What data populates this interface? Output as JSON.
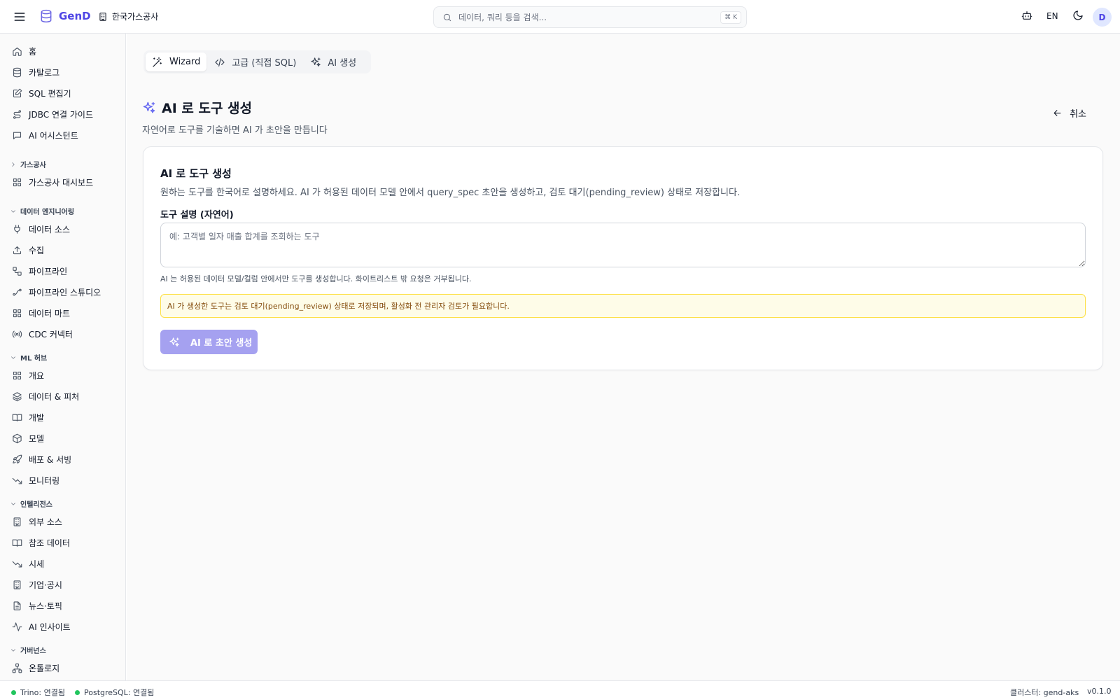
{
  "colors": {
    "accent": "#4f46e5",
    "status_ok": "#22c55e",
    "alert_bg": "#fefce8",
    "alert_border": "#fde047",
    "alert_text": "#854d0e"
  },
  "topbar": {
    "brand": "GenD",
    "org": "한국가스공사",
    "search_placeholder": "데이터, 쿼리 등을 검색...",
    "search_shortcut": "⌘ K",
    "lang": "EN",
    "avatar": "D"
  },
  "sidebar": {
    "items_top": [
      {
        "label": "홈",
        "icon": "home-icon"
      },
      {
        "label": "카탈로그",
        "icon": "database-icon"
      },
      {
        "label": "SQL 편집기",
        "icon": "edit-icon"
      },
      {
        "label": "JDBC 연결 가이드",
        "icon": "route-icon"
      },
      {
        "label": "AI 어시스턴트",
        "icon": "message-icon"
      }
    ],
    "sections": {
      "gas": "가스공사",
      "de": "데이터 엔지니어링",
      "ml": "ML 허브",
      "intel": "인텔리전스",
      "gov": "거버넌스"
    },
    "gas_items": [
      {
        "label": "가스공사 대시보드",
        "icon": "grid-icon"
      }
    ],
    "de_items": [
      {
        "label": "데이터 소스",
        "icon": "plug-icon"
      },
      {
        "label": "수집",
        "icon": "upload-icon"
      },
      {
        "label": "파이프라인",
        "icon": "workflow-icon"
      },
      {
        "label": "파이프라인 스튜디오",
        "icon": "spline-icon"
      },
      {
        "label": "데이터 마트",
        "icon": "grid-icon"
      },
      {
        "label": "CDC 커넥터",
        "icon": "radio-icon"
      }
    ],
    "ml_items": [
      {
        "label": "개요",
        "icon": "grid-icon"
      },
      {
        "label": "데이터 & 피처",
        "icon": "layers-icon"
      },
      {
        "label": "개발",
        "icon": "book-icon"
      },
      {
        "label": "모델",
        "icon": "box-icon"
      },
      {
        "label": "배포 & 서빙",
        "icon": "rocket-icon"
      },
      {
        "label": "모니터링",
        "icon": "trending-down-icon"
      }
    ],
    "intel_items": [
      {
        "label": "외부 소스",
        "icon": "building-icon"
      },
      {
        "label": "참조 데이터",
        "icon": "book-icon"
      },
      {
        "label": "시세",
        "icon": "trending-down-icon"
      },
      {
        "label": "기업·공시",
        "icon": "building-icon"
      },
      {
        "label": "뉴스·토픽",
        "icon": "file-icon"
      },
      {
        "label": "AI 인사이트",
        "icon": "activity-icon"
      }
    ],
    "gov_items": [
      {
        "label": "온톨로지",
        "icon": "network-icon"
      }
    ]
  },
  "main": {
    "tabs": [
      {
        "label": "Wizard",
        "icon": "wand-icon"
      },
      {
        "label": "고급 (직접 SQL)",
        "icon": "code-icon"
      },
      {
        "label": "AI 생성",
        "icon": "sparkles-icon"
      }
    ],
    "active_tab": "Wizard",
    "title": "AI 로 도구 생성",
    "subtitle": "자연어로 도구를 기술하면 AI 가 초안을 만듭니다",
    "cancel": "취소",
    "card": {
      "title": "AI 로 도구 생성",
      "description": "원하는 도구를 한국어로 설명하세요. AI 가 허용된 데이터 모델 안에서 query_spec 초안을 생성하고, 검토 대기(pending_review) 상태로 저장합니다.",
      "field_label": "도구 설명 (자연어)",
      "field_placeholder": "예: 고객별 일자 매출 합계를 조회하는 도구",
      "field_value": "",
      "hint": "AI 는 허용된 데이터 모델/컬럼 안에서만 도구를 생성합니다. 화이트리스트 밖 요청은 거부됩니다.",
      "alert": "AI 가 생성한 도구는 검토 대기(pending_review) 상태로 저장되며, 활성화 전 관리자 검토가 필요합니다.",
      "generate_button": "AI 로 초안 생성"
    }
  },
  "statusbar": {
    "trino": "Trino: 연결됨",
    "postgres": "PostgreSQL: 연결됨",
    "cluster": "클러스터: gend-aks",
    "version": "v0.1.0"
  }
}
